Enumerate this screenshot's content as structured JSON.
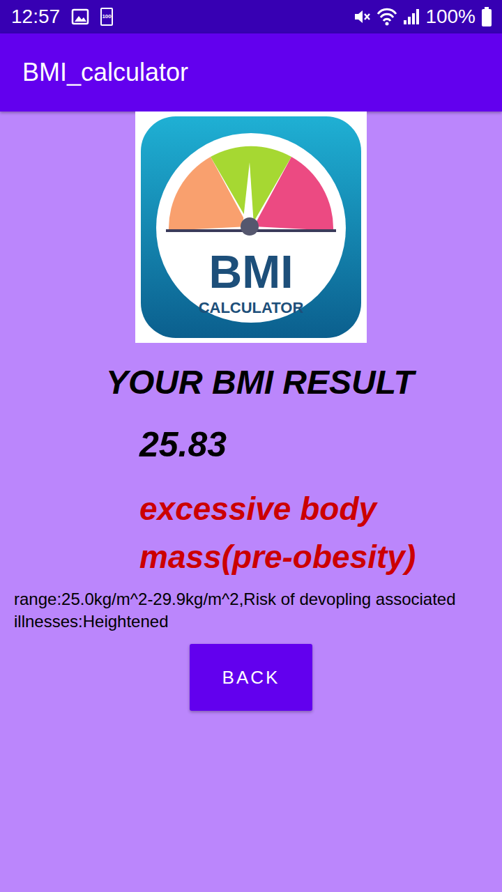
{
  "status_bar": {
    "time": "12:57",
    "notification_battery": "100",
    "battery": "100%"
  },
  "app_bar": {
    "title": "BMI_calculator"
  },
  "logo": {
    "title": "BMI",
    "subtitle": "CALCULATOR"
  },
  "result": {
    "heading": "YOUR BMI RESULT",
    "value": "25.83",
    "category": "excessive body mass(pre-obesity)",
    "description": "range:25.0kg/m^2-29.9kg/m^2,Risk of devopling associated illnesses:Heightened"
  },
  "buttons": [
    "BACK"
  ]
}
